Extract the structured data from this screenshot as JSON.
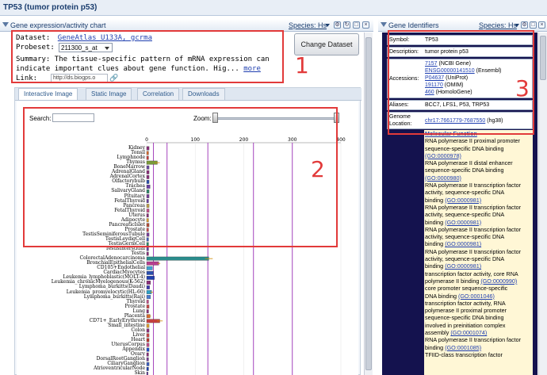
{
  "window": {
    "title": "TP53 (tumor protein p53)"
  },
  "expression_panel": {
    "title": "Gene expression/activity chart",
    "species_label": "Species: Hs",
    "dataset_label": "Dataset:",
    "dataset_value": "GeneAtlas U133A, gcrma",
    "probeset_label": "Probeset:",
    "probeset_value": "211300_s_at",
    "summary_label": "Summary:",
    "summary_text_1": "The tissue-specific pattern of mRNA expression can",
    "summary_text_2": "indicate important clues about gene function. Hig...",
    "more_link": "more",
    "link_label": "Link:",
    "link_value": "http://ds.biogps.o",
    "change_dataset_button": "Change Dataset",
    "tabs": [
      "Interactive Image",
      "Static Image",
      "Correlation",
      "Downloads"
    ],
    "search_label": "Search:",
    "zoom_label": "Zoom:"
  },
  "chart_data": {
    "type": "bar",
    "orientation": "horizontal",
    "xlim": [
      0,
      400
    ],
    "x_ticks": [
      "0",
      "100",
      "200",
      "300",
      "400"
    ],
    "reference_lines": [
      14,
      42,
      126
    ],
    "categories": [
      "Kidney",
      "Tonsil",
      "Lymphnode",
      "Thymus",
      "BoneMarrow",
      "AdrenalGland",
      "AdrenalCortex",
      "Olfactorybulb",
      "Trachea",
      "SalivaryGland",
      "Pituitary",
      "FetalThyroid",
      "Pancreas",
      "FetalThyroid",
      "Uterus",
      "Adipocyte",
      "PancreaticIslet",
      "Prostate",
      "TestisSeminiferousTubule",
      "TestisLeydigCell",
      "TestisGermCell",
      "TestisInterstitial",
      "Testis",
      "ColorectalAdenocarcinoma",
      "BronchialEpithelialCells",
      "CD105+Endothelial",
      "CardiacMyocytes",
      "Leukemia_lymphoblastic(MOLT-4)",
      "Leukemia_chronicMyelogenous(K-562)",
      "Lymphoma_burkitts(Daudi)",
      "Leukemia_promyelocytic(HL-60)",
      "Lymphoma_burkitts(Raji)",
      "Thyroid",
      "Prostate",
      "Lung",
      "Placenta",
      "CD71+_EarlyErythroid",
      "Small_intestine",
      "Colon",
      "Liver",
      "Heart",
      "UterusCorpus",
      "Appendix",
      "Ovary",
      "DorsalRootGanglion",
      "CiliaryGanglion",
      "AtrioventricularNode",
      "Skin"
    ],
    "values": [
      5,
      4,
      4,
      22,
      5,
      5,
      5,
      5,
      7,
      5,
      5,
      4,
      5,
      5,
      4,
      4,
      5,
      4,
      5,
      4,
      4,
      4,
      4,
      128,
      25,
      12,
      14,
      16,
      8,
      6,
      10,
      8,
      4,
      5,
      4,
      7,
      27,
      5,
      5,
      5,
      5,
      5,
      5,
      4,
      4,
      5,
      4,
      3
    ],
    "colors": [
      "#8b2f7a",
      "#d66b2f",
      "#c53f3f",
      "#7a9a3a",
      "#6b4aa1",
      "#8b2f7a",
      "#8b2f7a",
      "#2a4faf",
      "#6a3fa3",
      "#2e8a6a",
      "#7a3f9a",
      "#6a3fa3",
      "#c2a14a",
      "#c54f8a",
      "#8b2f7a",
      "#e0a030",
      "#b54f3a",
      "#cc4b4b",
      "#7a3f9a",
      "#3f5fbf",
      "#2e8a6a",
      "#6a3fa3",
      "#8b2f7a",
      "#2a8c8c",
      "#b83f8f",
      "#3fa0d0",
      "#2a4faf",
      "#1f3fb0",
      "#8b2f7a",
      "#3a3ab0",
      "#2aa0c8",
      "#4a7ad0",
      "#c54f8a",
      "#cc4b4b",
      "#8b2f7a",
      "#d66b2f",
      "#c53f3f",
      "#e0a030",
      "#8b2f7a",
      "#cc4b4b",
      "#b8382f",
      "#c54f8a",
      "#1f4fcf",
      "#8b2f7a",
      "#7a3f9a",
      "#3f5fbf",
      "#1f3fb0",
      "#6a3fa3"
    ],
    "error": [
      0,
      0,
      0,
      5,
      0,
      0,
      0,
      0,
      0,
      0,
      0,
      0,
      0,
      0,
      0,
      0,
      0,
      0,
      0,
      0,
      0,
      0,
      0,
      8,
      3,
      0,
      0,
      0,
      0,
      0,
      3,
      0,
      0,
      0,
      0,
      2,
      6,
      0,
      0,
      0,
      0,
      0,
      0,
      0,
      0,
      0,
      0,
      0
    ]
  },
  "gene_panel": {
    "title": "Gene Identifiers",
    "species_label": "Species: Hs",
    "symbol_label": "Symbol:",
    "symbol_value": "TP53",
    "description_label": "Description:",
    "description_value": "tumor protein p53",
    "accessions_label": "Accessions:",
    "accessions": [
      {
        "id": "7157",
        "source": "(NCBI Gene)"
      },
      {
        "id": "ENSG00000141510",
        "source": "(Ensembl)"
      },
      {
        "id": "P04637",
        "source": "(UniProt)"
      },
      {
        "id": "191170",
        "source": "(OMIM)"
      },
      {
        "id": "460",
        "source": "(HomoloGene)"
      }
    ],
    "aliases_label": "Aliases:",
    "aliases_value": "BCC7, LFS1, P53, TRP53",
    "genome_label_1": "Genome",
    "genome_label_2": "Location:",
    "genome_link": "chr17:7661779-7687550",
    "genome_build": "(hg38)",
    "go_heading": "Molecular Function",
    "go_lines": [
      "RNA polymerase II proximal promoter",
      "sequence-specific DNA binding",
      "(GO:0000978)",
      "RNA polymerase II distal enhancer",
      "sequence-specific DNA binding",
      "(GO:0000980)",
      "RNA polymerase II transcription factor",
      "activity, sequence-specific DNA",
      "binding (GO:0000981)",
      "RNA polymerase II transcription factor",
      "activity, sequence-specific DNA",
      "binding (GO:0000981)",
      "RNA polymerase II transcription factor",
      "activity, sequence-specific DNA",
      "binding (GO:0000981)",
      "RNA polymerase II transcription factor",
      "activity, sequence-specific DNA",
      "binding (GO:0000981)",
      "transcription factor activity, core RNA",
      "polymerase II binding (GO:0000990)",
      "core promoter sequence-specific",
      "DNA binding (GO:0001046)",
      "transcription factor activity, RNA",
      "polymerase II proximal promoter",
      "sequence-specific DNA binding",
      "involved in preinitiation complex",
      "assembly (GO:0001074)",
      "RNA polymerase II transcription factor",
      "binding (GO:0001085)",
      "TFIID-class transcription factor"
    ]
  },
  "annotations": [
    "1",
    "2",
    "3"
  ],
  "colors": {
    "annotation": "#e23a3a",
    "panel_dark": "#14124e",
    "link": "#1f3fb0"
  }
}
